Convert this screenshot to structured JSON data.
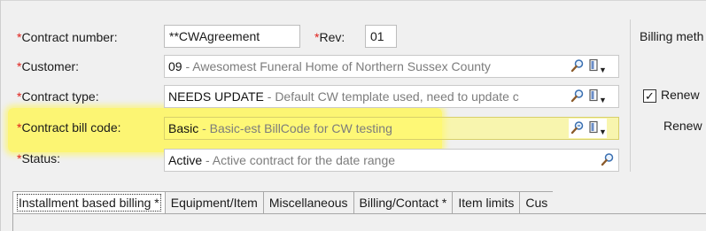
{
  "form": {
    "contract_number": {
      "label": "Contract number:",
      "value": "**CWAgreement"
    },
    "rev": {
      "label": "Rev:",
      "value": "01"
    },
    "customer": {
      "label": "Customer:",
      "code": "09",
      "desc": " - Awesomest Funeral Home of Northern Sussex County"
    },
    "contract_type": {
      "label": "Contract type:",
      "code": "NEEDS UPDATE",
      "desc": " - Default CW template used, need to update c"
    },
    "contract_bill_code": {
      "label": "Contract bill code:",
      "code": "Basic",
      "desc": " - Basic-est BillCode for CW testing"
    },
    "status": {
      "label": "Status:",
      "code": "Active",
      "desc": " - Active contract for the date range"
    },
    "required_mark": "*"
  },
  "right_panel": {
    "billing_method_label": "Billing meth",
    "renew_checkbox_label": "Renew",
    "renew_checked": true,
    "renew_label_2": "Renew"
  },
  "tabs": [
    {
      "label": "Installment based billing *",
      "active": true
    },
    {
      "label": "Equipment/Item",
      "active": false
    },
    {
      "label": "Miscellaneous",
      "active": false
    },
    {
      "label": "Billing/Contact *",
      "active": false
    },
    {
      "label": "Item limits",
      "active": false
    },
    {
      "label": "Cus",
      "active": false
    }
  ],
  "icons": {
    "lookup": "magnifier-icon",
    "lookup_filtered": "magnifier-filter-icon",
    "document_menu": "document-dropdown-icon"
  },
  "colors": {
    "required": "#e0201a",
    "highlight": "#fff650",
    "description": "#7c7c7c"
  }
}
